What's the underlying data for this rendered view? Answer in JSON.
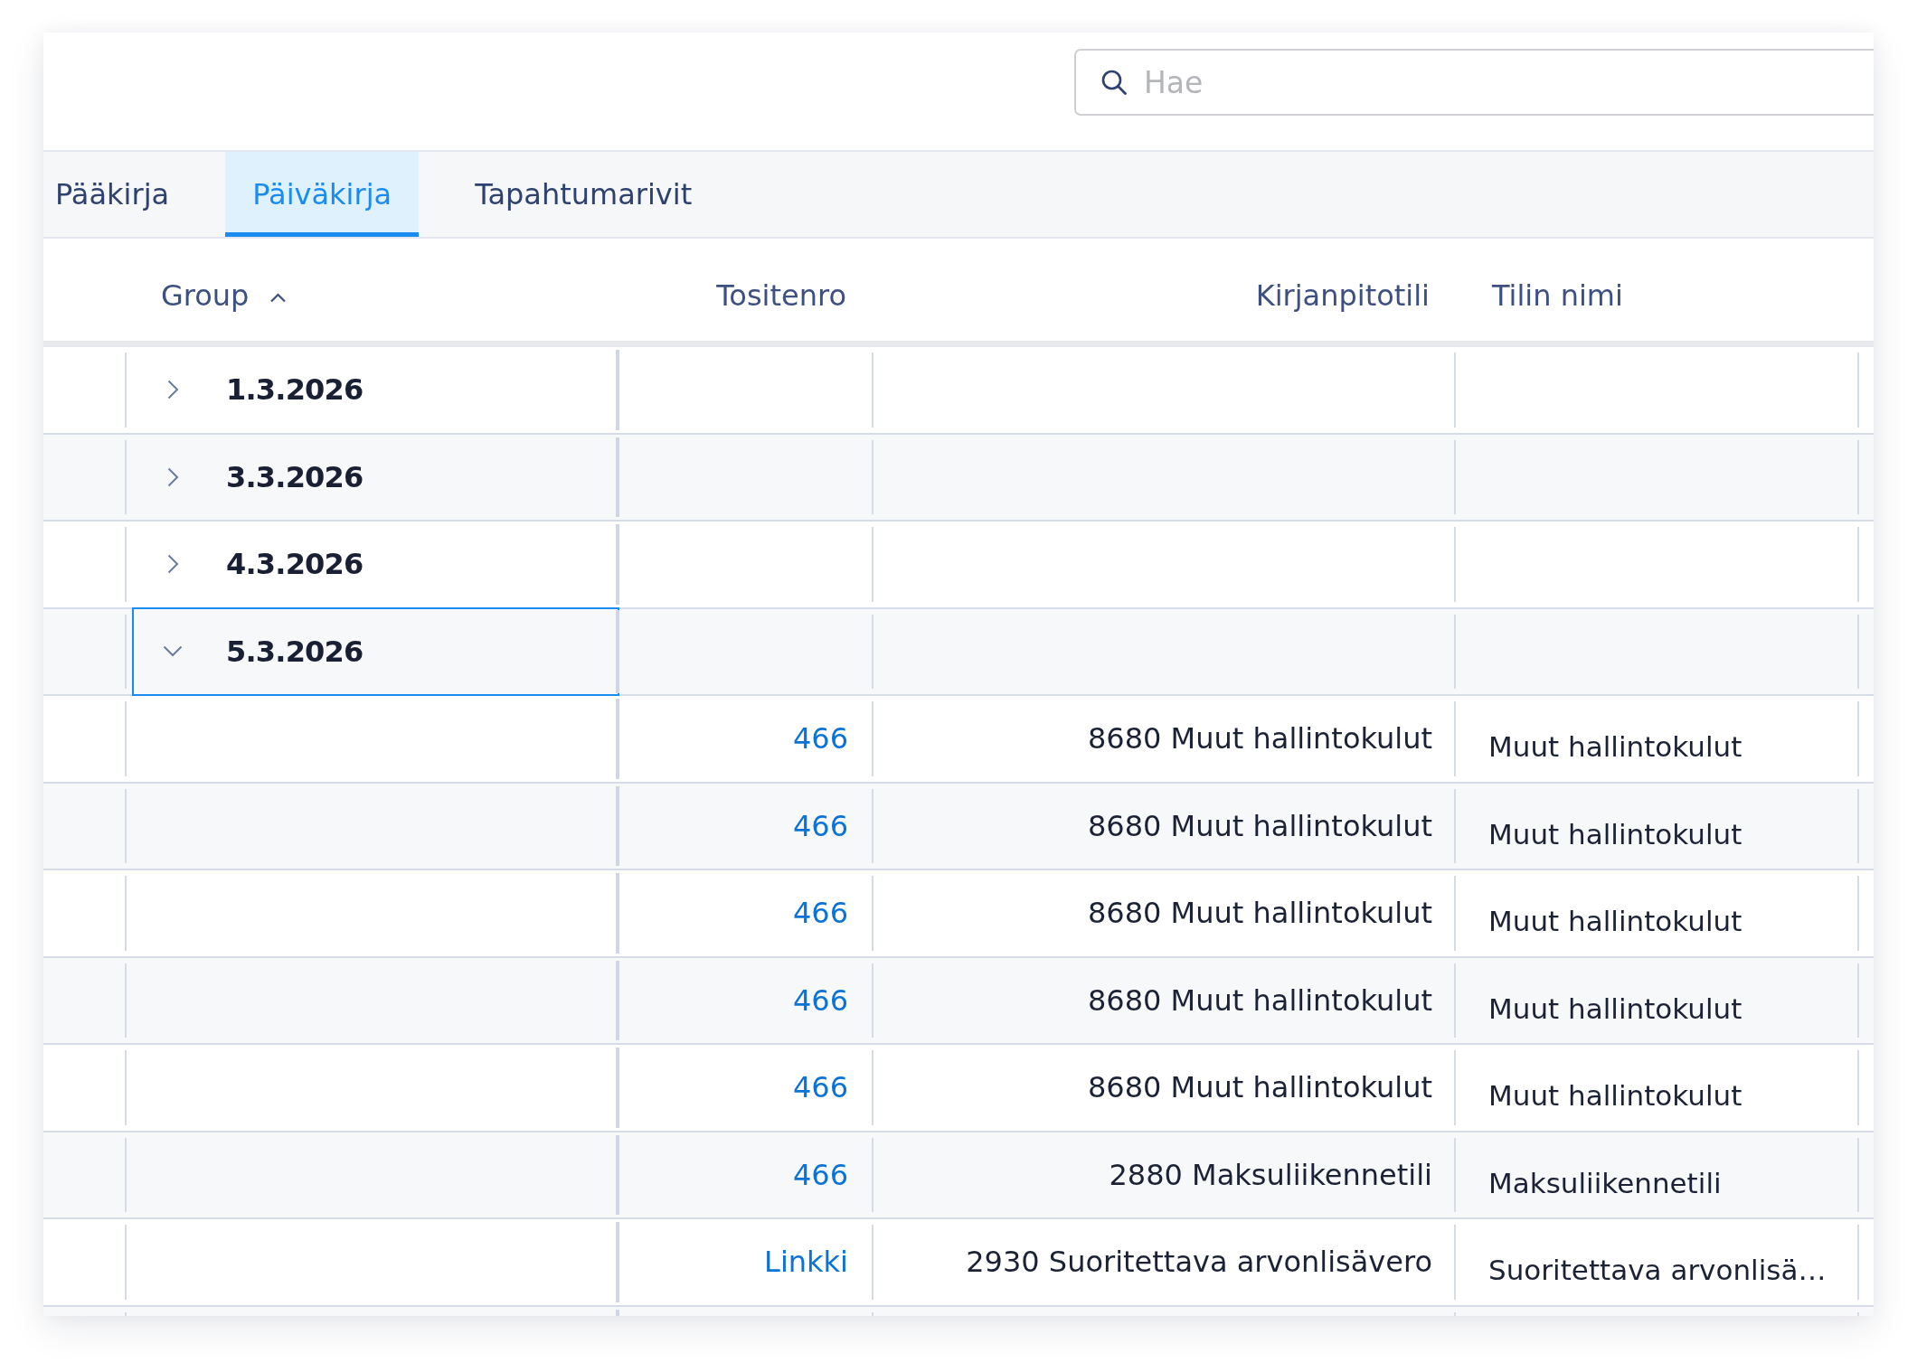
{
  "search": {
    "placeholder": "Hae"
  },
  "tabs": [
    {
      "label": "Pääkirja",
      "selected": false
    },
    {
      "label": "Päiväkirja",
      "selected": true
    },
    {
      "label": "Tapahtumarivit",
      "selected": false
    }
  ],
  "table": {
    "columns": [
      {
        "label": "Group",
        "sorted": true
      },
      {
        "label": "Tositenro",
        "sorted": false
      },
      {
        "label": "Kirjanpitotili",
        "sorted": false
      },
      {
        "label": "Tilin nimi",
        "sorted": false
      }
    ],
    "rows": [
      {
        "kind": "group",
        "group": "1.3.2026",
        "expanded": false,
        "focused": false
      },
      {
        "kind": "group",
        "group": "3.3.2026",
        "expanded": false,
        "focused": false
      },
      {
        "kind": "group",
        "group": "4.3.2026",
        "expanded": false,
        "focused": false
      },
      {
        "kind": "group",
        "group": "5.3.2026",
        "expanded": true,
        "focused": true
      },
      {
        "kind": "entry",
        "tositenro": "466",
        "kirjanpitotili": "8680 Muut hallintokulut",
        "tilin_nimi": "Muut hallintokulut"
      },
      {
        "kind": "entry",
        "tositenro": "466",
        "kirjanpitotili": "8680 Muut hallintokulut",
        "tilin_nimi": "Muut hallintokulut"
      },
      {
        "kind": "entry",
        "tositenro": "466",
        "kirjanpitotili": "8680 Muut hallintokulut",
        "tilin_nimi": "Muut hallintokulut"
      },
      {
        "kind": "entry",
        "tositenro": "466",
        "kirjanpitotili": "8680 Muut hallintokulut",
        "tilin_nimi": "Muut hallintokulut"
      },
      {
        "kind": "entry",
        "tositenro": "466",
        "kirjanpitotili": "8680 Muut hallintokulut",
        "tilin_nimi": "Muut hallintokulut"
      },
      {
        "kind": "entry",
        "tositenro": "466",
        "kirjanpitotili": "2880 Maksuliikennetili",
        "tilin_nimi": "Maksuliikennetili"
      },
      {
        "kind": "entry",
        "tositenro": "Linkki",
        "kirjanpitotili": "2930 Suoritettava arvonlisävero",
        "tilin_nimi": "Suoritettava arvonlisä…"
      }
    ]
  }
}
